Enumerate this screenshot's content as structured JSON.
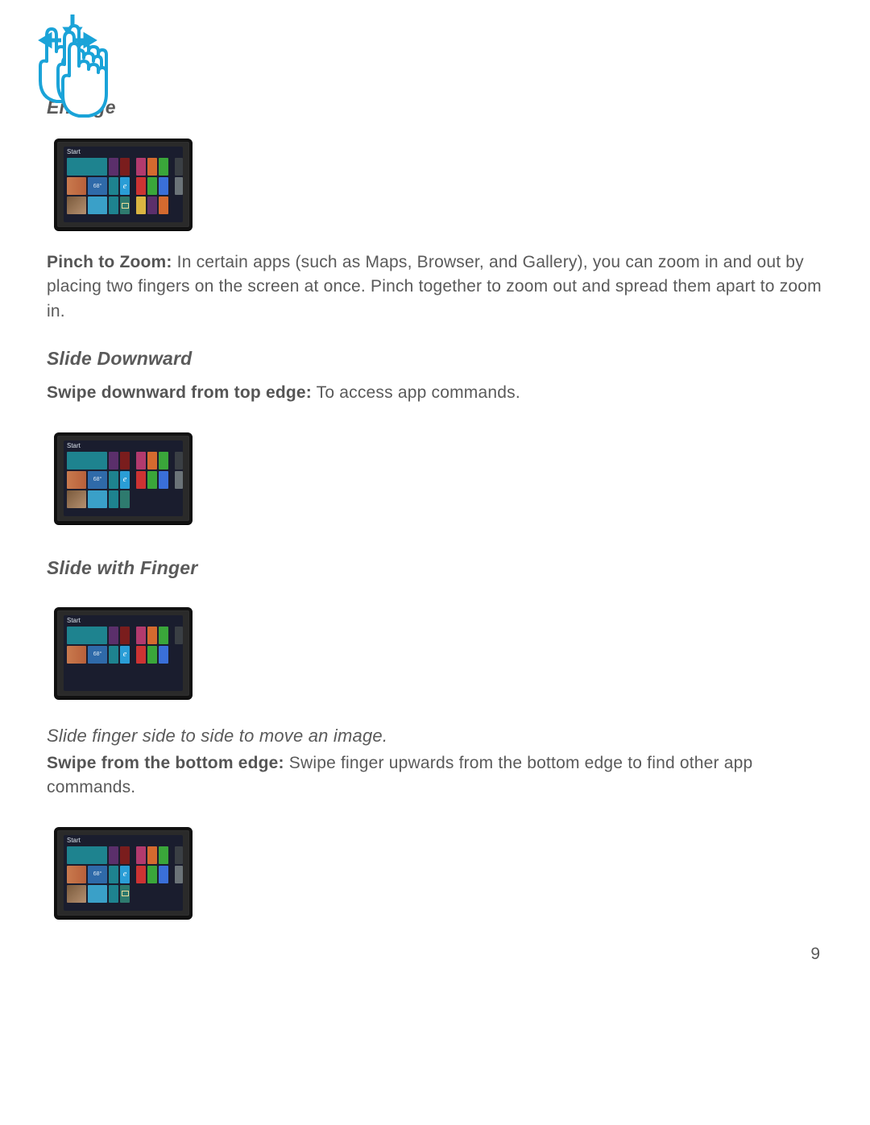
{
  "section1": {
    "heading": "Enlarge",
    "boldLead": "Pinch to Zoom:",
    "text": " In certain apps (such as Maps, Browser, and Gallery), you can zoom in and out by placing two fingers on the screen at once. Pinch together to zoom out and spread them apart to zoom in."
  },
  "section2": {
    "heading": "Slide Downward",
    "boldLead": "Swipe downward from top edge:",
    "text": " To access app commands."
  },
  "section3": {
    "heading": "Slide with Finger",
    "caption": "Slide finger side to side to move an image.",
    "boldLead": "Swipe from the bottom edge:",
    "text": " Swipe finger upwards from the bottom edge to find other app commands."
  },
  "tablet": {
    "startLabel": "Start",
    "tempTile": "68°"
  },
  "pageNumber": "9"
}
